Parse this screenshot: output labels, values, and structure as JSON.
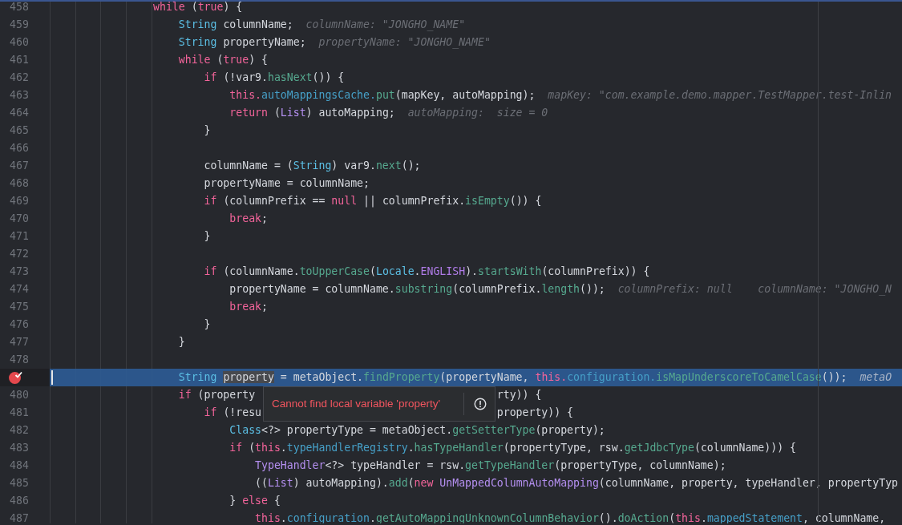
{
  "editor": {
    "lines": [
      {
        "number": "458",
        "current": false,
        "breakpoint": false,
        "segments": [
          {
            "kind": "kw",
            "text": "                while"
          },
          {
            "kind": "plain",
            "text": " ("
          },
          {
            "kind": "kw",
            "text": "true"
          },
          {
            "kind": "plain",
            "text": ") {"
          }
        ]
      },
      {
        "number": "459",
        "current": false,
        "breakpoint": false,
        "segments": [
          {
            "kind": "type",
            "text": "                    String"
          },
          {
            "kind": "plain",
            "text": " columnName;"
          }
        ],
        "hints": [
          "columnName: \"JONGHO_NAME\""
        ]
      },
      {
        "number": "460",
        "current": false,
        "breakpoint": false,
        "segments": [
          {
            "kind": "type",
            "text": "                    String"
          },
          {
            "kind": "plain",
            "text": " propertyName;"
          }
        ],
        "hints": [
          "propertyName: \"JONGHO_NAME\""
        ]
      },
      {
        "number": "461",
        "current": false,
        "breakpoint": false,
        "segments": [
          {
            "kind": "kw",
            "text": "                    while"
          },
          {
            "kind": "plain",
            "text": " ("
          },
          {
            "kind": "kw",
            "text": "true"
          },
          {
            "kind": "plain",
            "text": ") {"
          }
        ]
      },
      {
        "number": "462",
        "current": false,
        "breakpoint": false,
        "segments": [
          {
            "kind": "kw",
            "text": "                        if"
          },
          {
            "kind": "plain",
            "text": " (!var9."
          },
          {
            "kind": "method",
            "text": "hasNext"
          },
          {
            "kind": "plain",
            "text": "()) {"
          }
        ]
      },
      {
        "number": "463",
        "current": false,
        "breakpoint": false,
        "segments": [
          {
            "kind": "kw",
            "text": "                            this."
          },
          {
            "kind": "field",
            "text": "autoMappingsCache."
          },
          {
            "kind": "method",
            "text": "put"
          },
          {
            "kind": "plain",
            "text": "(mapKey, autoMapping);"
          }
        ],
        "hints": [
          "mapKey: \"com.example.demo.mapper.TestMapper.test-Inlin"
        ]
      },
      {
        "number": "464",
        "current": false,
        "breakpoint": false,
        "segments": [
          {
            "kind": "kw",
            "text": "                            return"
          },
          {
            "kind": "plain",
            "text": " ("
          },
          {
            "kind": "cls",
            "text": "List"
          },
          {
            "kind": "plain",
            "text": ") autoMapping;"
          }
        ],
        "hints": [
          "autoMapping:  size = 0"
        ]
      },
      {
        "number": "465",
        "current": false,
        "breakpoint": false,
        "segments": [
          {
            "kind": "plain",
            "text": "                        }"
          }
        ]
      },
      {
        "number": "466",
        "current": false,
        "breakpoint": false
      },
      {
        "number": "467",
        "current": false,
        "breakpoint": false,
        "segments": [
          {
            "kind": "plain",
            "text": "                        columnName = ("
          },
          {
            "kind": "type",
            "text": "String"
          },
          {
            "kind": "plain",
            "text": ") var9."
          },
          {
            "kind": "method",
            "text": "next"
          },
          {
            "kind": "plain",
            "text": "();"
          }
        ]
      },
      {
        "number": "468",
        "current": false,
        "breakpoint": false,
        "segments": [
          {
            "kind": "plain",
            "text": "                        propertyName = columnName;"
          }
        ]
      },
      {
        "number": "469",
        "current": false,
        "breakpoint": false,
        "segments": [
          {
            "kind": "kw",
            "text": "                        if"
          },
          {
            "kind": "plain",
            "text": " (columnPrefix == "
          },
          {
            "kind": "kw",
            "text": "null"
          },
          {
            "kind": "plain",
            "text": " || columnPrefix."
          },
          {
            "kind": "method",
            "text": "isEmpty"
          },
          {
            "kind": "plain",
            "text": "()) {"
          }
        ]
      },
      {
        "number": "470",
        "current": false,
        "breakpoint": false,
        "segments": [
          {
            "kind": "kw",
            "text": "                            break"
          },
          {
            "kind": "plain",
            "text": ";"
          }
        ]
      },
      {
        "number": "471",
        "current": false,
        "breakpoint": false,
        "segments": [
          {
            "kind": "plain",
            "text": "                        }"
          }
        ]
      },
      {
        "number": "472",
        "current": false,
        "breakpoint": false
      },
      {
        "number": "473",
        "current": false,
        "breakpoint": false,
        "segments": [
          {
            "kind": "kw",
            "text": "                        if"
          },
          {
            "kind": "plain",
            "text": " (columnName."
          },
          {
            "kind": "method",
            "text": "toUpperCase"
          },
          {
            "kind": "plain",
            "text": "("
          },
          {
            "kind": "type",
            "text": "Locale"
          },
          {
            "kind": "plain",
            "text": "."
          },
          {
            "kind": "const",
            "text": "ENGLISH"
          },
          {
            "kind": "plain",
            "text": ")."
          },
          {
            "kind": "method",
            "text": "startsWith"
          },
          {
            "kind": "plain",
            "text": "(columnPrefix)) {"
          }
        ]
      },
      {
        "number": "474",
        "current": false,
        "breakpoint": false,
        "segments": [
          {
            "kind": "plain",
            "text": "                            propertyName = columnName."
          },
          {
            "kind": "method",
            "text": "substring"
          },
          {
            "kind": "plain",
            "text": "(columnPrefix."
          },
          {
            "kind": "method",
            "text": "length"
          },
          {
            "kind": "plain",
            "text": "());"
          }
        ],
        "hints": [
          "columnPrefix: null",
          "columnName: \"JONGHO_N"
        ]
      },
      {
        "number": "475",
        "current": false,
        "breakpoint": false,
        "segments": [
          {
            "kind": "kw",
            "text": "                            break"
          },
          {
            "kind": "plain",
            "text": ";"
          }
        ]
      },
      {
        "number": "476",
        "current": false,
        "breakpoint": false,
        "segments": [
          {
            "kind": "plain",
            "text": "                        }"
          }
        ]
      },
      {
        "number": "477",
        "current": false,
        "breakpoint": false,
        "segments": [
          {
            "kind": "plain",
            "text": "                    }"
          }
        ]
      },
      {
        "number": "478",
        "current": false,
        "breakpoint": false
      },
      {
        "current": true,
        "breakpoint": true,
        "segments": [
          {
            "kind": "type",
            "text": "                    String "
          },
          {
            "kind": "sel",
            "text": "property"
          },
          {
            "kind": "plain",
            "text": " = metaObject."
          },
          {
            "kind": "method",
            "text": "findProperty"
          },
          {
            "kind": "plain",
            "text": "(propertyName, "
          },
          {
            "kind": "kw",
            "text": "this."
          },
          {
            "kind": "field",
            "text": "configuration."
          },
          {
            "kind": "method",
            "text": "isMapUnderscoreToCamelCase"
          },
          {
            "kind": "plain",
            "text": "());"
          }
        ],
        "hints": [
          "metaO"
        ]
      },
      {
        "number": "480",
        "current": false,
        "breakpoint": false,
        "segments": [
          {
            "kind": "kw",
            "text": "                    if"
          },
          {
            "kind": "plain",
            "text": " (property "
          },
          {
            "kind": "covered"
          },
          {
            "kind": "plain",
            "text": "rty)) {"
          }
        ]
      },
      {
        "number": "481",
        "current": false,
        "breakpoint": false,
        "segments": [
          {
            "kind": "kw",
            "text": "                        if"
          },
          {
            "kind": "plain",
            "text": " (!resu"
          },
          {
            "kind": "covered"
          },
          {
            "kind": "plain",
            "text": "property)) {"
          }
        ]
      },
      {
        "number": "482",
        "current": false,
        "breakpoint": false,
        "segments": [
          {
            "kind": "type",
            "text": "                            Class"
          },
          {
            "kind": "plain",
            "text": "<?> propertyType = metaObject."
          },
          {
            "kind": "method",
            "text": "getSetterType"
          },
          {
            "kind": "plain",
            "text": "(property);"
          }
        ]
      },
      {
        "number": "483",
        "current": false,
        "breakpoint": false,
        "segments": [
          {
            "kind": "kw",
            "text": "                            if"
          },
          {
            "kind": "plain",
            "text": " ("
          },
          {
            "kind": "kw",
            "text": "this"
          },
          {
            "kind": "plain",
            "text": "."
          },
          {
            "kind": "field",
            "text": "typeHandlerRegistry"
          },
          {
            "kind": "plain",
            "text": "."
          },
          {
            "kind": "method",
            "text": "hasTypeHandler"
          },
          {
            "kind": "plain",
            "text": "(propertyType, rsw."
          },
          {
            "kind": "method",
            "text": "getJdbcType"
          },
          {
            "kind": "plain",
            "text": "(columnName))) {"
          }
        ]
      },
      {
        "number": "484",
        "current": false,
        "breakpoint": false,
        "segments": [
          {
            "kind": "cls",
            "text": "                                TypeHandler"
          },
          {
            "kind": "plain",
            "text": "<?> typeHandler = rsw."
          },
          {
            "kind": "method",
            "text": "getTypeHandler"
          },
          {
            "kind": "plain",
            "text": "(propertyType, columnName);"
          }
        ]
      },
      {
        "number": "485",
        "current": false,
        "breakpoint": false,
        "segments": [
          {
            "kind": "plain",
            "text": "                                (("
          },
          {
            "kind": "cls",
            "text": "List"
          },
          {
            "kind": "plain",
            "text": ") autoMapping)."
          },
          {
            "kind": "method",
            "text": "add"
          },
          {
            "kind": "plain",
            "text": "("
          },
          {
            "kind": "kw",
            "text": "new "
          },
          {
            "kind": "cls",
            "text": "UnMappedColumnAutoMapping"
          },
          {
            "kind": "plain",
            "text": "(columnName, property, typeHandler, propertyTyp"
          }
        ]
      },
      {
        "number": "486",
        "current": false,
        "breakpoint": false,
        "segments": [
          {
            "kind": "plain",
            "text": "                            } "
          },
          {
            "kind": "kw",
            "text": "else"
          },
          {
            "kind": "plain",
            "text": " {"
          }
        ]
      },
      {
        "number": "487",
        "current": false,
        "breakpoint": false,
        "segments": [
          {
            "kind": "kw",
            "text": "                                this"
          },
          {
            "kind": "plain",
            "text": "."
          },
          {
            "kind": "field",
            "text": "configuration"
          },
          {
            "kind": "plain",
            "text": "."
          },
          {
            "kind": "method",
            "text": "getAutoMappingUnknownColumnBehavior"
          },
          {
            "kind": "plain",
            "text": "()."
          },
          {
            "kind": "method",
            "text": "doAction"
          },
          {
            "kind": "plain",
            "text": "("
          },
          {
            "kind": "kw",
            "text": "this"
          },
          {
            "kind": "plain",
            "text": "."
          },
          {
            "kind": "field",
            "text": "mappedStatement"
          },
          {
            "kind": "plain",
            "text": ", columnName,"
          }
        ]
      }
    ],
    "error_popup": {
      "message": "Cannot find local variable 'property'"
    }
  }
}
